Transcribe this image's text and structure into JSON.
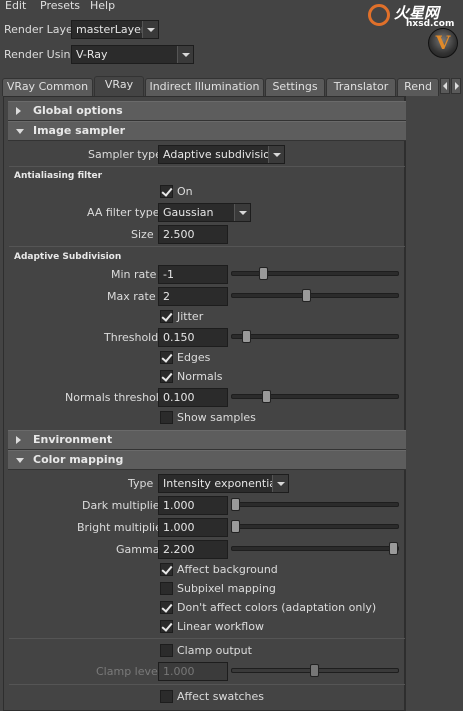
{
  "menu": [
    "Edit",
    "Presets",
    "Help"
  ],
  "watermark": {
    "title": "火星网",
    "sub": "hxsd.com"
  },
  "logo": {
    "letter": "V"
  },
  "render_layer": {
    "label": "Render Layer",
    "value": "masterLayer"
  },
  "render_using": {
    "label": "Render Using",
    "value": "V-Ray"
  },
  "tabs": [
    "VRay Common",
    "VRay",
    "Indirect Illumination",
    "Settings",
    "Translator",
    "Rend"
  ],
  "active_tab": "VRay",
  "sections": {
    "global": "Global options",
    "image_sampler": "Image sampler",
    "environment": "Environment",
    "color_mapping": "Color mapping"
  },
  "image_sampler": {
    "sampler_type_label": "Sampler type",
    "sampler_type_value": "Adaptive subdivision",
    "aa_heading": "Antialiasing filter",
    "aa_on_label": "On",
    "aa_filter_type_label": "AA filter type",
    "aa_filter_type_value": "Gaussian",
    "size_label": "Size",
    "size_value": "2.500",
    "adaptive_heading": "Adaptive Subdivision",
    "min_rate_label": "Min rate",
    "min_rate_value": "-1",
    "max_rate_label": "Max rate",
    "max_rate_value": "2",
    "jitter_label": "Jitter",
    "threshold_label": "Threshold",
    "threshold_value": "0.150",
    "edges_label": "Edges",
    "normals_label": "Normals",
    "normals_threshold_label": "Normals threshold",
    "normals_threshold_value": "0.100",
    "show_samples_label": "Show samples"
  },
  "color_mapping": {
    "type_label": "Type",
    "type_value": "Intensity exponential",
    "dark_label": "Dark multiplier",
    "dark_value": "1.000",
    "bright_label": "Bright multiplier",
    "bright_value": "1.000",
    "gamma_label": "Gamma",
    "gamma_value": "2.200",
    "affect_background": "Affect background",
    "subpixel_mapping": "Subpixel mapping",
    "dont_affect_colors": "Don't affect colors (adaptation only)",
    "linear_workflow": "Linear workflow",
    "clamp_output": "Clamp output",
    "clamp_level_label": "Clamp level",
    "clamp_level_value": "1.000",
    "affect_swatches": "Affect swatches"
  }
}
